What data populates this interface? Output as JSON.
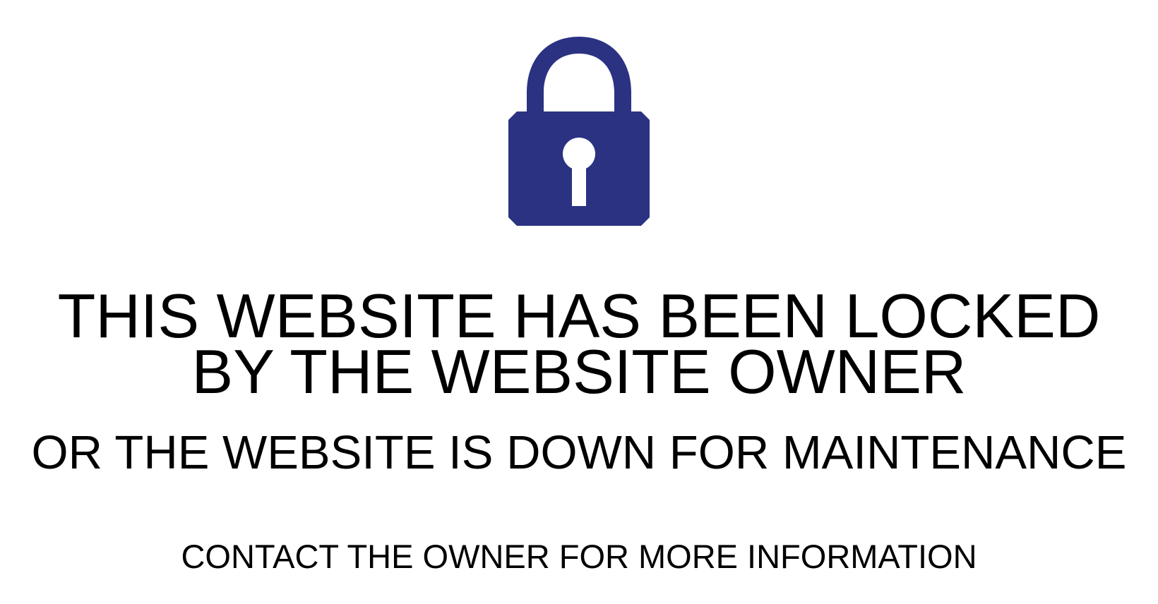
{
  "lock": {
    "icon": "lock-icon",
    "color": "#2b3282"
  },
  "message": {
    "line1": "THIS WEBSITE HAS BEEN LOCKED",
    "line2": "BY THE WEBSITE OWNER",
    "line3": "OR THE WEBSITE IS DOWN FOR MAINTENANCE",
    "line4": "CONTACT THE OWNER FOR MORE INFORMATION"
  }
}
